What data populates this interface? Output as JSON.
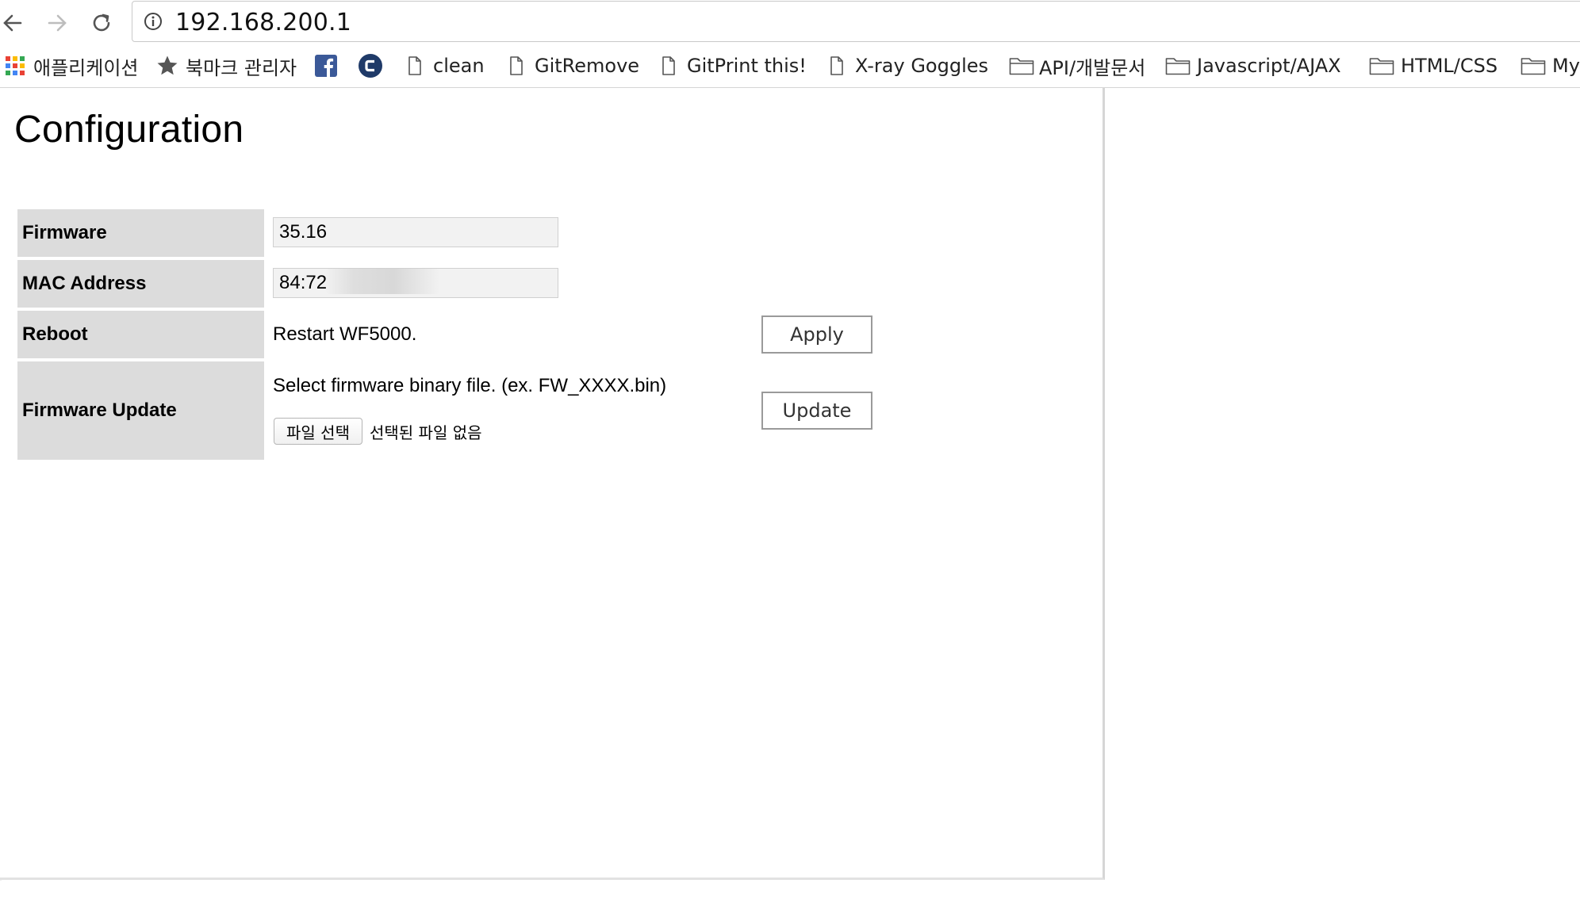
{
  "browser": {
    "url": "192.168.200.1",
    "bookmarks": [
      {
        "label": "애플리케이션",
        "icon": "apps-grid-icon"
      },
      {
        "label": "북마크 관리자",
        "icon": "star-icon"
      },
      {
        "label": "",
        "icon": "facebook-icon"
      },
      {
        "label": "",
        "icon": "c-logo-icon"
      },
      {
        "label": "clean",
        "icon": "page-icon"
      },
      {
        "label": "GitRemove",
        "icon": "page-icon"
      },
      {
        "label": "GitPrint this!",
        "icon": "page-icon"
      },
      {
        "label": "X-ray Goggles",
        "icon": "page-icon"
      },
      {
        "label": "API/개발문서",
        "icon": "folder-icon"
      },
      {
        "label": "Javascript/AJAX",
        "icon": "folder-icon"
      },
      {
        "label": "HTML/CSS",
        "icon": "folder-icon"
      },
      {
        "label": "My",
        "icon": "folder-icon"
      }
    ]
  },
  "page": {
    "title": "Configuration",
    "rows": {
      "firmware": {
        "label": "Firmware",
        "value": "35.16"
      },
      "mac": {
        "label": "MAC Address",
        "value": "84:72"
      },
      "reboot": {
        "label": "Reboot",
        "description": "Restart WF5000.",
        "button": "Apply"
      },
      "update": {
        "label": "Firmware Update",
        "description": "Select firmware binary file. (ex. FW_XXXX.bin)",
        "file_button": "파일 선택",
        "file_status": "선택된 파일 없음",
        "button": "Update"
      }
    }
  },
  "colors": {
    "label_bg": "#dcdcdc",
    "field_bg": "#f2f2f2",
    "facebook_blue": "#3b5998",
    "c_logo": "#1f3a68"
  }
}
